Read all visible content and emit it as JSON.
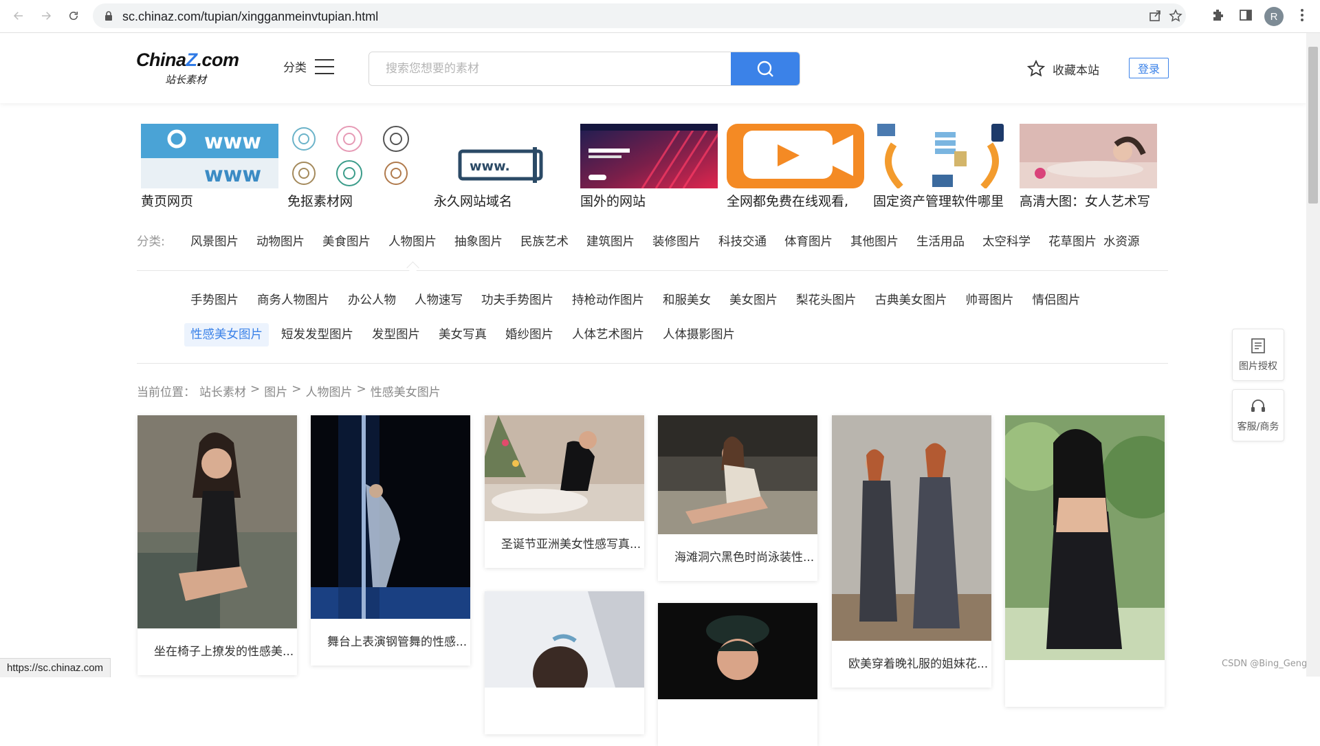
{
  "browser": {
    "url": "sc.chinaz.com/tupian/xingganmeinvtupian.html",
    "profile_initial": "R",
    "status_url": "https://sc.chinaz.com"
  },
  "header": {
    "logo_main_a": "China",
    "logo_main_z": "Z",
    "logo_main_b": ".com",
    "logo_sub": "站长素材",
    "category_label": "分类",
    "search_placeholder": "搜索您想要的素材",
    "bookmark_label": "收藏本站",
    "login_label": "登录"
  },
  "ads": [
    {
      "label": "黄页网页"
    },
    {
      "label": "免抠素材网"
    },
    {
      "label": "永久网站域名"
    },
    {
      "label": "国外的网站"
    },
    {
      "label": "全网都免费在线观看,"
    },
    {
      "label": "固定资产管理软件哪里"
    },
    {
      "label": "高清大图：女人艺术写"
    }
  ],
  "categories": {
    "title": "分类:",
    "items": [
      "风景图片",
      "动物图片",
      "美食图片",
      "人物图片",
      "抽象图片",
      "民族艺术",
      "建筑图片",
      "装修图片",
      "科技交通",
      "体育图片",
      "其他图片",
      "生活用品",
      "太空科学",
      "花草图片",
      "水资源"
    ]
  },
  "subcategories": {
    "row1": [
      "手势图片",
      "商务人物图片",
      "办公人物",
      "人物速写",
      "功夫手势图片",
      "持枪动作图片",
      "和服美女",
      "美女图片",
      "梨花头图片",
      "古典美女图片",
      "帅哥图片",
      "情侣图片"
    ],
    "row2": [
      "性感美女图片",
      "短发发型图片",
      "发型图片",
      "美女写真",
      "婚纱图片",
      "人体艺术图片",
      "人体摄影图片"
    ]
  },
  "breadcrumb": {
    "prefix": "当前位置：",
    "items": [
      "站长素材",
      "图片",
      "人物图片",
      "性感美女图片"
    ],
    "sep": ">"
  },
  "gallery": [
    {
      "caption": "坐在椅子上撩发的性感美..."
    },
    {
      "caption": "舞台上表演钢管舞的性感..."
    },
    {
      "caption": "圣诞节亚洲美女性感写真..."
    },
    {
      "caption": "海滩洞穴黑色时尚泳装性..."
    },
    {
      "caption": "欧美穿着晚礼服的姐妹花..."
    },
    {
      "caption": ""
    },
    {
      "caption": ""
    },
    {
      "caption": ""
    }
  ],
  "side": {
    "license_label": "图片授权",
    "service_label": "客服/商务"
  },
  "watermark": "CSDN @Bing_Geng"
}
